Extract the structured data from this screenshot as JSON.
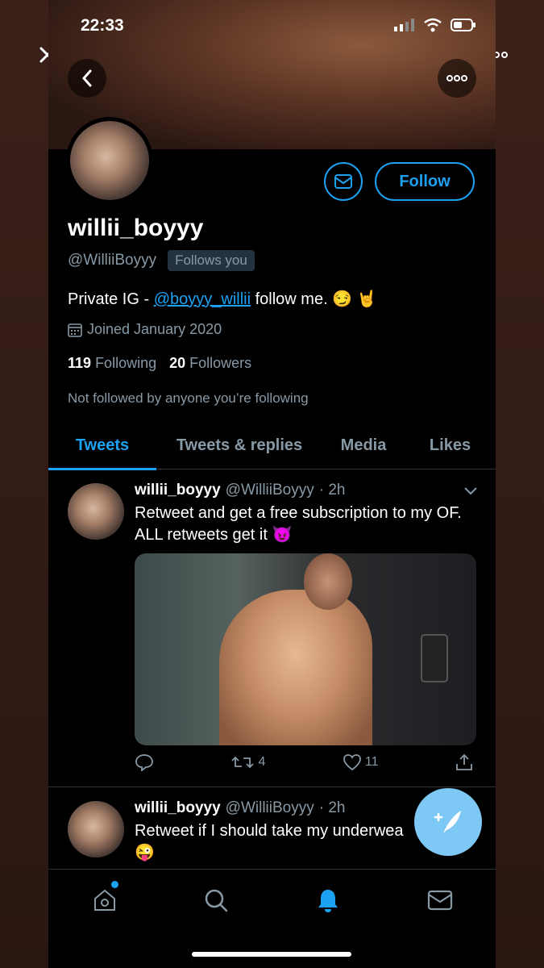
{
  "status_bar": {
    "time": "22:33"
  },
  "profile": {
    "display_name": "willii_boyyy",
    "handle": "@WilliiBoyyy",
    "follows_you": "Follows you",
    "bio_prefix": "Private IG - ",
    "bio_link": "@boyyy_willii",
    "bio_suffix": " follow me. 😏 🤘",
    "joined": "Joined January 2020",
    "following_count": "119",
    "following_label": "Following",
    "followers_count": "20",
    "followers_label": "Followers",
    "not_followed": "Not followed by anyone you’re following",
    "follow_button": "Follow"
  },
  "tabs": [
    {
      "label": "Tweets",
      "active": true
    },
    {
      "label": "Tweets & replies",
      "active": false
    },
    {
      "label": "Media",
      "active": false
    },
    {
      "label": "Likes",
      "active": false
    }
  ],
  "tweets": [
    {
      "name": "willii_boyyy",
      "handle": "@WilliiBoyyy",
      "time": "· 2h",
      "text": "Retweet and get a free subscription to my OF. ALL retweets get it 😈",
      "retweets": "4",
      "likes": "11"
    },
    {
      "name": "willii_boyyy",
      "handle": "@WilliiBoyyy",
      "time": "· 2h",
      "text": "Retweet if I should take my underwea",
      "text_line2": "😜"
    }
  ],
  "colors": {
    "accent": "#1da1f2",
    "muted": "#8899a6",
    "background": "#000000"
  },
  "icons": [
    "close-icon",
    "more-icon",
    "back-icon",
    "mail-icon",
    "calendar-icon",
    "reply-icon",
    "retweet-icon",
    "like-icon",
    "share-icon",
    "chevron-down-icon",
    "compose-icon",
    "home-icon",
    "search-icon",
    "notifications-icon",
    "messages-icon"
  ]
}
